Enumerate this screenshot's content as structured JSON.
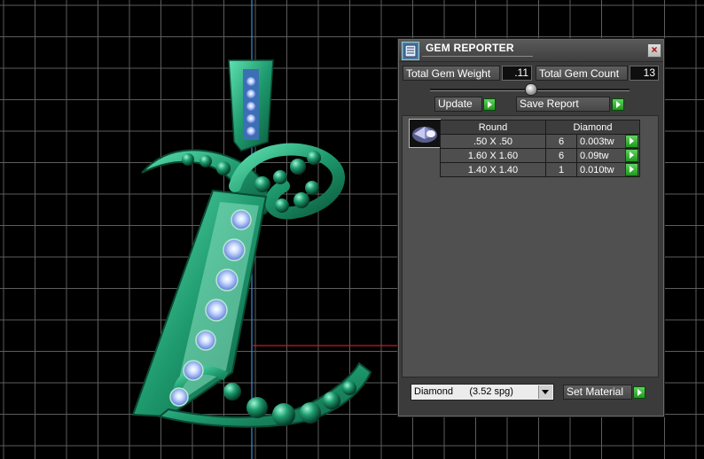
{
  "viewport": {
    "description_icon": "jewelry-pendant-model",
    "grid_color": "#6e6e6e",
    "background": "#000000"
  },
  "panel": {
    "title": "GEM REPORTER",
    "close_label": "×",
    "total_gem_weight_label": "Total Gem Weight",
    "total_gem_weight_value": ".11",
    "total_gem_count_label": "Total Gem Count",
    "total_gem_count_value": "13",
    "update_label": "Update",
    "save_report_label": "Save Report",
    "table": {
      "headers": [
        "Round",
        "Diamond"
      ],
      "rows": [
        {
          "size": ".50 X .50",
          "count": "6",
          "weight": "0.003tw"
        },
        {
          "size": "1.60 X 1.60",
          "count": "6",
          "weight": "0.09tw"
        },
        {
          "size": "1.40 X 1.40",
          "count": "1",
          "weight": "0.010tw"
        }
      ]
    },
    "material_select_value": "Diamond      (3.52 spg)",
    "set_material_label": "Set Material",
    "accent_green": "#2fb52f"
  }
}
